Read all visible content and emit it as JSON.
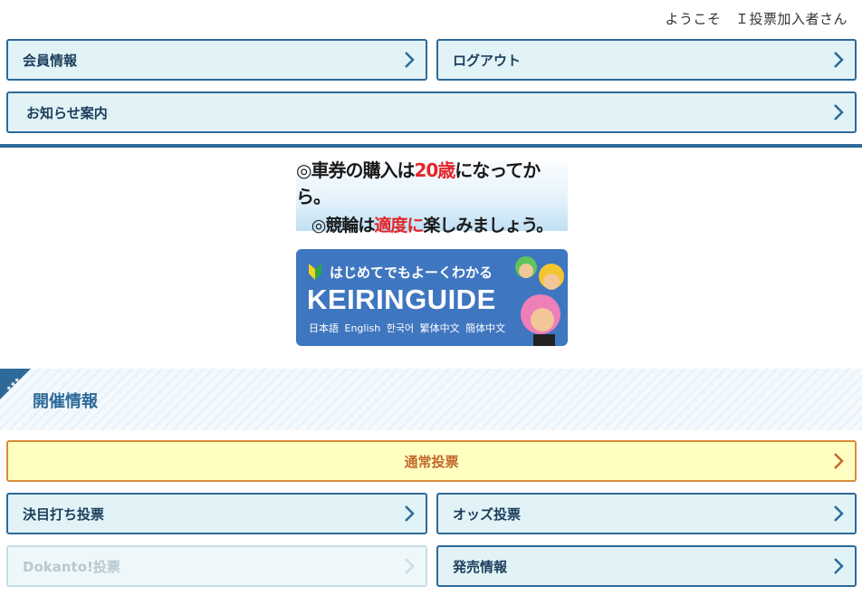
{
  "header": {
    "welcome": "ようこそ　Ｉ投票加入者さん"
  },
  "menu": {
    "member_info": "会員情報",
    "logout": "ログアウト",
    "notices": "お知らせ案内"
  },
  "banner_notice": {
    "line1_pre": "◎車券の購入は",
    "line1_red": "20歳",
    "line1_post": "になってから。",
    "line2_pre": "◎競輪は",
    "line2_red": "適度に",
    "line2_post": "楽しみましょう。"
  },
  "banner_guide": {
    "subtitle": "はじめてでもよーくわかる",
    "title": "KEIRINGUIDE",
    "languages": "日本語 English 한국어 繁体中文 簡体中文"
  },
  "section": {
    "title": "開催情報"
  },
  "betting": {
    "normal": "通常投票",
    "kettei": "決目打ち投票",
    "odds": "オッズ投票",
    "dokanto": "Dokanto!投票",
    "sales": "発売情報"
  },
  "colors": {
    "primary": "#2d6a99",
    "button_bg": "#e1f3f6",
    "highlight_bg": "#ffffc2",
    "highlight_border": "#d98a3a"
  }
}
